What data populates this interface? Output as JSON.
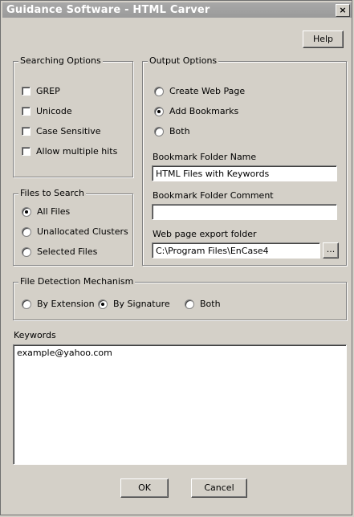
{
  "window": {
    "title": "Guidance Software - HTML Carver",
    "close_glyph": "×"
  },
  "help_button": "Help",
  "searching_options": {
    "label": "Searching Options",
    "items": [
      {
        "label": "GREP",
        "checked": false
      },
      {
        "label": "Unicode",
        "checked": false
      },
      {
        "label": "Case Sensitive",
        "checked": false
      },
      {
        "label": "Allow multiple hits",
        "checked": false
      }
    ]
  },
  "files_to_search": {
    "label": "Files to Search",
    "items": [
      {
        "label": "All Files",
        "selected": true
      },
      {
        "label": "Unallocated Clusters",
        "selected": false
      },
      {
        "label": "Selected Files",
        "selected": false
      }
    ]
  },
  "output_options": {
    "label": "Output Options",
    "items": [
      {
        "label": "Create Web Page",
        "selected": false
      },
      {
        "label": "Add Bookmarks",
        "selected": true
      },
      {
        "label": "Both",
        "selected": false
      }
    ],
    "bookmark_folder_name_label": "Bookmark Folder Name",
    "bookmark_folder_name_value": "HTML Files with Keywords",
    "bookmark_folder_comment_label": "Bookmark Folder Comment",
    "bookmark_folder_comment_value": "",
    "export_folder_label": "Web page export folder",
    "export_folder_value": "C:\\Program Files\\EnCase4",
    "browse_label": "..."
  },
  "file_detection": {
    "label": "File Detection Mechanism",
    "items": [
      {
        "label": "By Extension",
        "selected": false
      },
      {
        "label": "By Signature",
        "selected": true
      },
      {
        "label": "Both",
        "selected": false
      }
    ]
  },
  "keywords": {
    "label": "Keywords",
    "value": "example@yahoo.com"
  },
  "ok_button": "OK",
  "cancel_button": "Cancel"
}
